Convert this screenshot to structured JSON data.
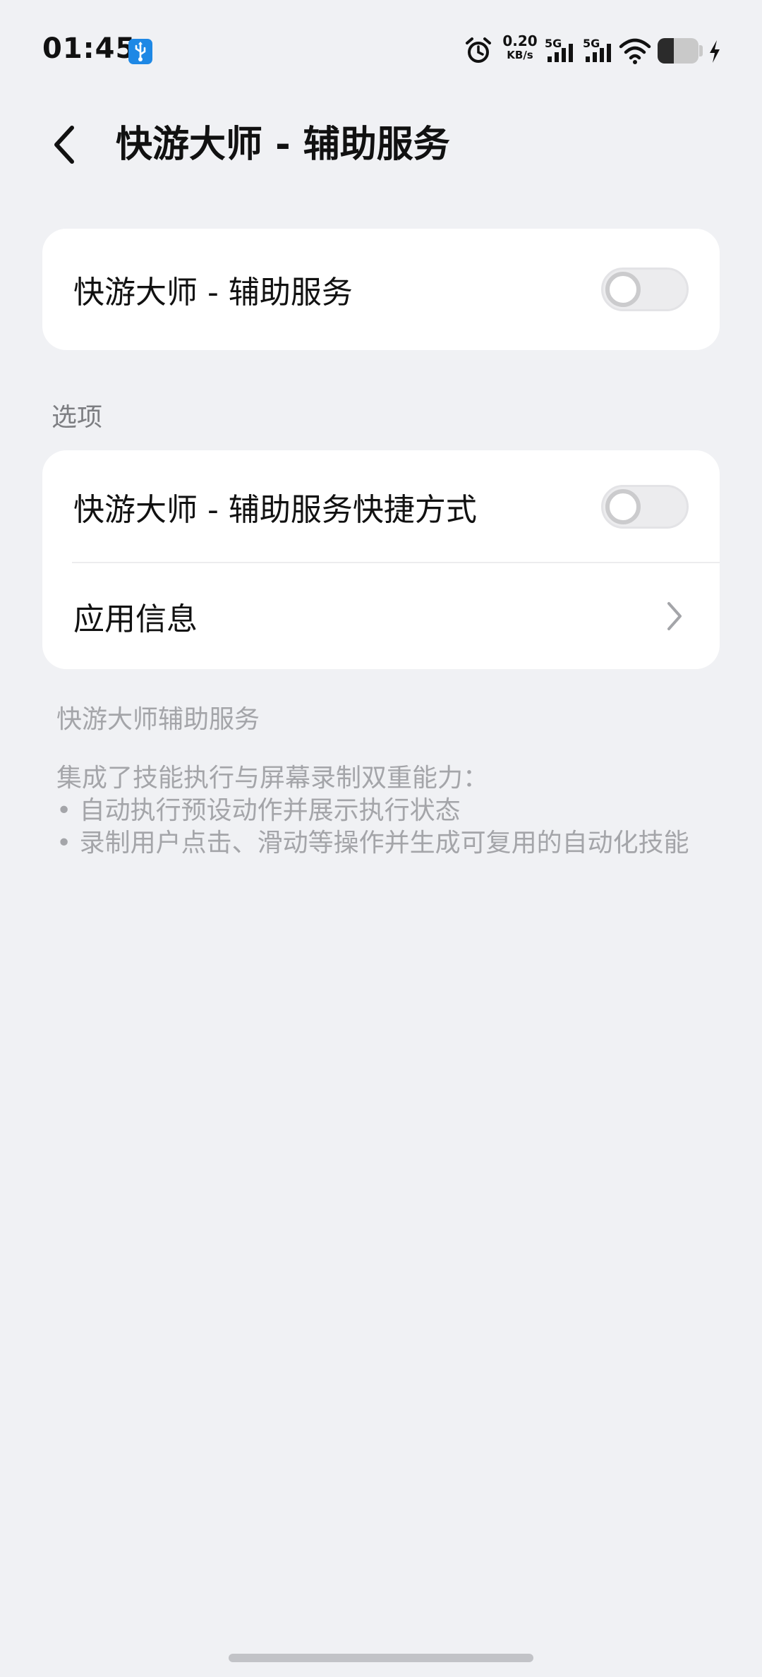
{
  "status_bar": {
    "time": "01:45",
    "net_speed_value": "0.20",
    "net_speed_unit": "KB/s",
    "sim1_type": "5G",
    "sim2_type": "5G",
    "battery_level": 0.4,
    "icons": [
      "usb-debug-icon",
      "alarm-icon",
      "signal-icon",
      "wifi-icon",
      "battery-icon",
      "charging-icon"
    ]
  },
  "header": {
    "title": "快游大师 - 辅助服务"
  },
  "main_toggle": {
    "label": "快游大师 - 辅助服务",
    "enabled": false
  },
  "options": {
    "section_label": "选项",
    "shortcut": {
      "label": "快游大师 - 辅助服务快捷方式",
      "enabled": false
    },
    "app_info": {
      "label": "应用信息"
    }
  },
  "description": {
    "title": "快游大师辅助服务",
    "lines": [
      "集成了技能执行与屏幕录制双重能力：",
      "• 自动执行预设动作并展示执行状态",
      "• 录制用户点击、滑动等操作并生成可复用的自动化技能"
    ]
  },
  "colors": {
    "background": "#f0f1f4",
    "card": "#ffffff",
    "usb_badge": "#1e88e5",
    "secondary_text": "#a4a5a9"
  }
}
